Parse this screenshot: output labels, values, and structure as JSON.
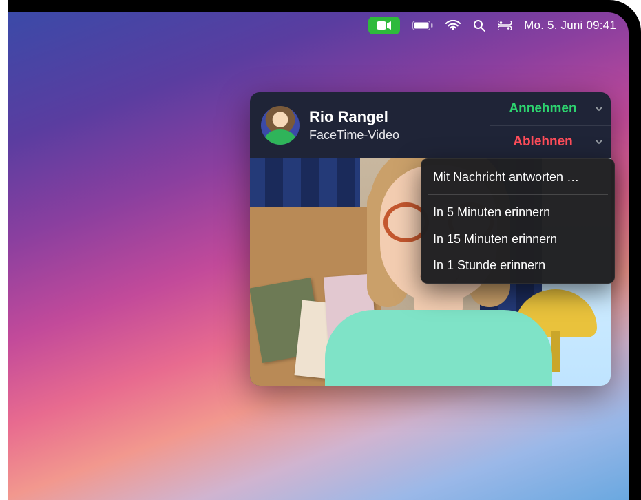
{
  "menubar": {
    "clock": "Mo. 5. Juni  09:41"
  },
  "notification": {
    "caller_name": "Rio Rangel",
    "caller_subtitle": "FaceTime-Video",
    "accept_label": "Annehmen",
    "decline_label": "Ablehnen"
  },
  "decline_menu": {
    "reply_with_message": "Mit Nachricht antworten …",
    "remind_5": "In 5 Minuten erinnern",
    "remind_15": "In 15 Minuten erinnern",
    "remind_60": "In 1 Stunde erinnern"
  }
}
